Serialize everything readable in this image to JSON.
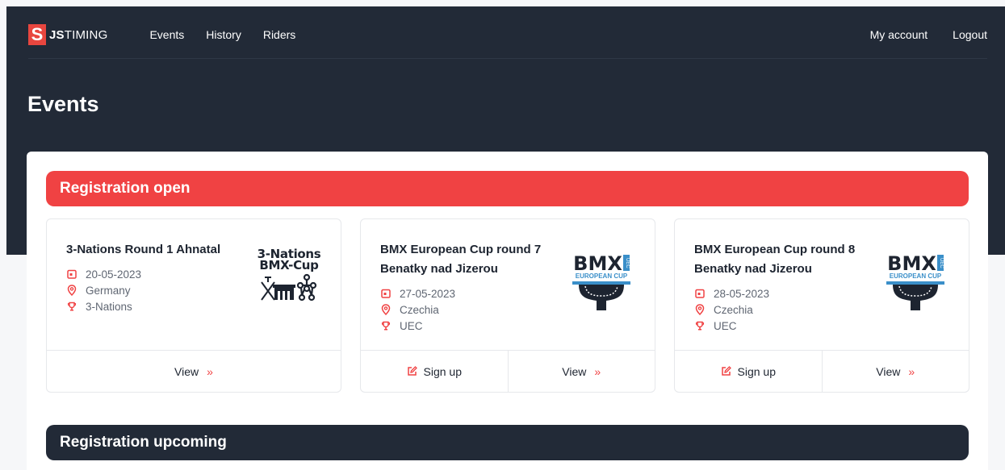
{
  "nav": {
    "logo_mark": "S",
    "logo_bold": "JS",
    "logo_light": "TIMING",
    "links": [
      "Events",
      "History",
      "Riders"
    ],
    "account": "My account",
    "logout": "Logout"
  },
  "page_title": "Events",
  "colors": {
    "header_bg": "#222a37",
    "accent_red": "#f04243"
  },
  "sections": {
    "open": "Registration open",
    "upcoming": "Registration upcoming"
  },
  "events": [
    {
      "title": "3-Nations Round 1 Ahnatal",
      "date": "20-05-2023",
      "country": "Germany",
      "series": "3-Nations",
      "logo_line1": "3-Nations",
      "logo_line2": "BMX-Cup",
      "view_label": "View",
      "chevron": "»"
    },
    {
      "title": "BMX European Cup round 7 Benatky nad Jizerou",
      "date": "27-05-2023",
      "country": "Czechia",
      "series": "UEC",
      "logo_main": "BMX",
      "logo_sub": "EUROPEAN CUP",
      "logo_tag": "UEC",
      "signup_label": "Sign up",
      "view_label": "View",
      "chevron": "»"
    },
    {
      "title": "BMX European Cup round 8 Benatky nad Jizerou",
      "date": "28-05-2023",
      "country": "Czechia",
      "series": "UEC",
      "logo_main": "BMX",
      "logo_sub": "EUROPEAN CUP",
      "logo_tag": "UEC",
      "signup_label": "Sign up",
      "view_label": "View",
      "chevron": "»"
    }
  ]
}
